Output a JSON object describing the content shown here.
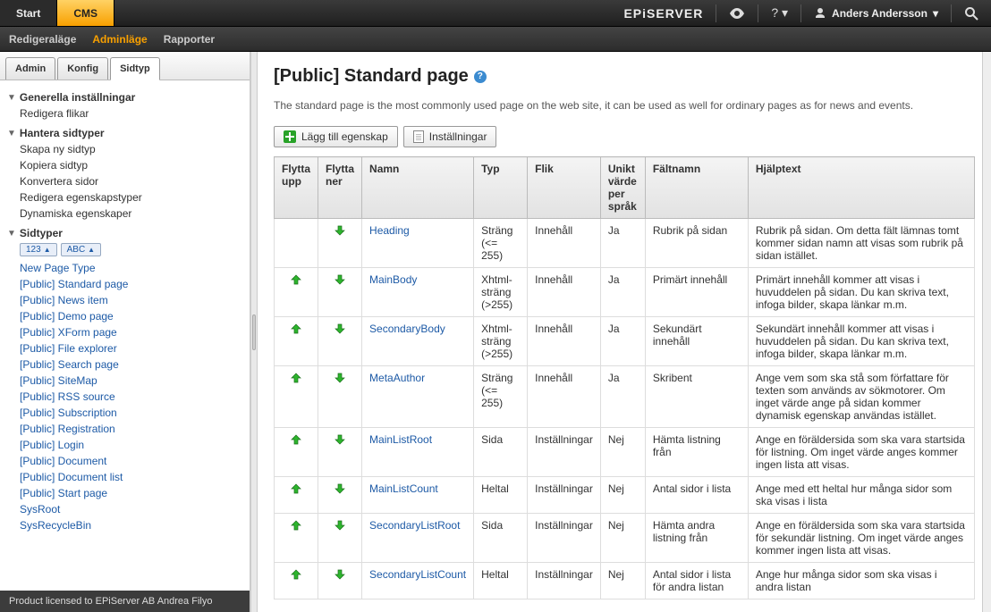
{
  "topbar": {
    "start_label": "Start",
    "cms_label": "CMS",
    "brand": "EPiSERVER",
    "user_name": "Anders Andersson"
  },
  "secondbar": {
    "items": [
      {
        "label": "Redigeraläge",
        "active": false
      },
      {
        "label": "Adminläge",
        "active": true
      },
      {
        "label": "Rapporter",
        "active": false
      }
    ]
  },
  "left_tabs": {
    "items": [
      {
        "label": "Admin",
        "active": false
      },
      {
        "label": "Konfig",
        "active": false
      },
      {
        "label": "Sidtyp",
        "active": true
      }
    ]
  },
  "sidebar": {
    "sections": [
      {
        "title": "Generella inställningar",
        "items": [
          {
            "label": "Redigera flikar"
          }
        ]
      },
      {
        "title": "Hantera sidtyper",
        "items": [
          {
            "label": "Skapa ny sidtyp"
          },
          {
            "label": "Kopiera sidtyp"
          },
          {
            "label": "Konvertera sidor"
          },
          {
            "label": "Redigera egenskapstyper"
          },
          {
            "label": "Dynamiska egenskaper"
          }
        ]
      },
      {
        "title": "Sidtyper",
        "sorters": [
          "123",
          "ABC"
        ],
        "items": [
          {
            "label": "New Page Type"
          },
          {
            "label": "[Public] Standard page"
          },
          {
            "label": "[Public] News item"
          },
          {
            "label": "[Public] Demo page"
          },
          {
            "label": "[Public] XForm page"
          },
          {
            "label": "[Public] File explorer"
          },
          {
            "label": "[Public] Search page"
          },
          {
            "label": "[Public] SiteMap"
          },
          {
            "label": "[Public] RSS source"
          },
          {
            "label": "[Public] Subscription"
          },
          {
            "label": "[Public] Registration"
          },
          {
            "label": "[Public] Login"
          },
          {
            "label": "[Public] Document"
          },
          {
            "label": "[Public] Document list"
          },
          {
            "label": "[Public] Start page"
          },
          {
            "label": "SysRoot"
          },
          {
            "label": "SysRecycleBin"
          }
        ]
      }
    ]
  },
  "license_text": "Product licensed to EPiServer AB Andrea Filyo",
  "page": {
    "title": "[Public] Standard page",
    "description": "The standard page is the most commonly used page on the web site, it can be used as well for ordinary pages as for news and events.",
    "add_label": "Lägg till egenskap",
    "settings_label": "Inställningar"
  },
  "table": {
    "headers": {
      "move_up": "Flytta upp",
      "move_down": "Flytta ner",
      "name": "Namn",
      "type": "Typ",
      "tab": "Flik",
      "unique": "Unikt värde per språk",
      "fieldname": "Fältnamn",
      "helptext": "Hjälptext"
    },
    "rows": [
      {
        "up": false,
        "down": true,
        "name": "Heading",
        "type": "Sträng (<= 255)",
        "tab": "Innehåll",
        "unique": "Ja",
        "fieldname": "Rubrik på sidan",
        "help": "Rubrik på sidan. Om detta fält lämnas tomt kommer sidan namn att visas som rubrik på sidan istället."
      },
      {
        "up": true,
        "down": true,
        "name": "MainBody",
        "type": "Xhtml-sträng (>255)",
        "tab": "Innehåll",
        "unique": "Ja",
        "fieldname": "Primärt innehåll",
        "help": "Primärt innehåll kommer att visas i huvuddelen på sidan. Du kan skriva text, infoga bilder, skapa länkar m.m."
      },
      {
        "up": true,
        "down": true,
        "name": "SecondaryBody",
        "type": "Xhtml-sträng (>255)",
        "tab": "Innehåll",
        "unique": "Ja",
        "fieldname": "Sekundärt innehåll",
        "help": "Sekundärt innehåll kommer att visas i huvuddelen på sidan. Du kan skriva text, infoga bilder, skapa länkar m.m."
      },
      {
        "up": true,
        "down": true,
        "name": "MetaAuthor",
        "type": "Sträng (<= 255)",
        "tab": "Innehåll",
        "unique": "Ja",
        "fieldname": "Skribent",
        "help": "Ange vem som ska stå som författare för texten som används av sökmotorer. Om inget värde ange på sidan kommer dynamisk egenskap användas istället."
      },
      {
        "up": true,
        "down": true,
        "name": "MainListRoot",
        "type": "Sida",
        "tab": "Inställningar",
        "unique": "Nej",
        "fieldname": "Hämta listning från",
        "help": "Ange en föräldersida som ska vara startsida för listning. Om inget värde anges kommer ingen lista att visas."
      },
      {
        "up": true,
        "down": true,
        "name": "MainListCount",
        "type": "Heltal",
        "tab": "Inställningar",
        "unique": "Nej",
        "fieldname": "Antal sidor i lista",
        "help": "Ange med ett heltal hur många sidor som ska visas i lista"
      },
      {
        "up": true,
        "down": true,
        "name": "SecondaryListRoot",
        "type": "Sida",
        "tab": "Inställningar",
        "unique": "Nej",
        "fieldname": "Hämta andra listning från",
        "help": "Ange en föräldersida som ska vara startsida för sekundär listning. Om inget värde anges kommer ingen lista att visas."
      },
      {
        "up": true,
        "down": true,
        "name": "SecondaryListCount",
        "type": "Heltal",
        "tab": "Inställningar",
        "unique": "Nej",
        "fieldname": "Antal sidor i lista för andra listan",
        "help": "Ange hur många sidor som ska visas i andra listan"
      }
    ]
  }
}
